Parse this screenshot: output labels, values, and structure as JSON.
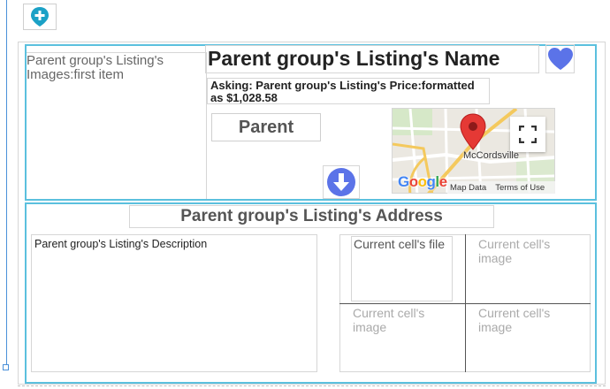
{
  "toolbar": {
    "add_icon": "plus-location-icon"
  },
  "listing": {
    "images_text": "Parent group's Listing's Images:first item",
    "name": "Parent group's Listing's Name",
    "price": "Asking: Parent group's Listing's Price:formatted as $1,028.58",
    "parent_button": "Parent",
    "heart_icon": "heart-icon",
    "down_icon": "arrow-down-circle-icon",
    "address": "Parent group's Listing's Address",
    "description": "Parent group's Listing's Description"
  },
  "map": {
    "city": "McCordsville",
    "logo": "Google",
    "data_label": "Map Data",
    "terms_label": "Terms of Use"
  },
  "cells": {
    "file": "Current cell's file",
    "image1": "Current cell's image",
    "image2": "Current cell's image",
    "image3": "Current cell's image"
  },
  "colors": {
    "accent": "#5bc0de",
    "icon_blue": "#5b73e8",
    "add_teal": "#1ba1c6"
  }
}
